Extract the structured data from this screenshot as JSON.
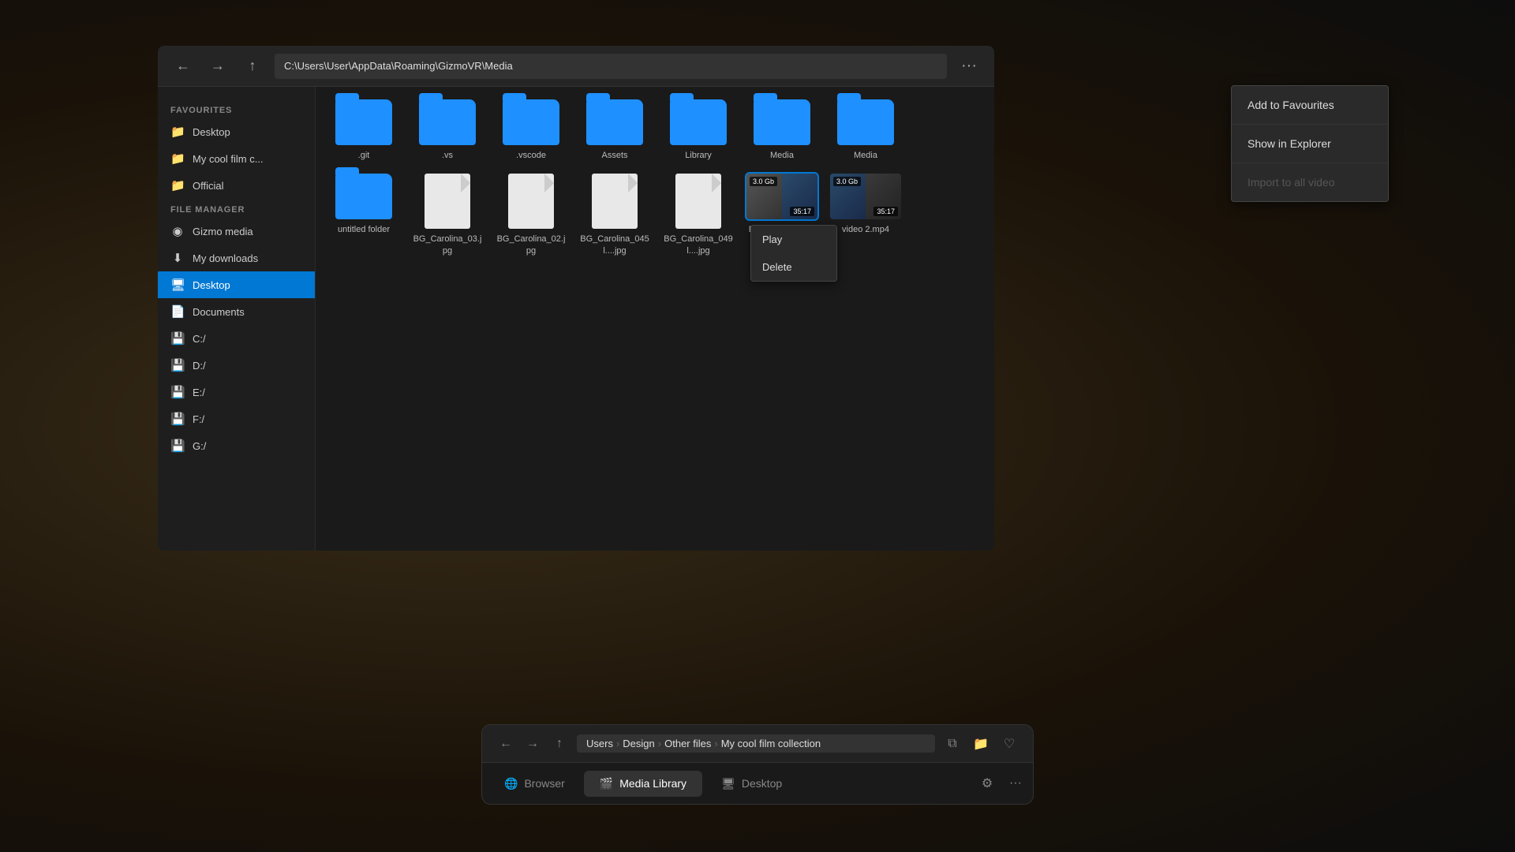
{
  "background": {
    "color": "#2a2010"
  },
  "window": {
    "titlebar": {
      "back_label": "←",
      "forward_label": "→",
      "up_label": "↑",
      "address": "C:\\Users\\User\\AppData\\Roaming\\GizmoVR\\Media",
      "more_label": "···"
    },
    "sidebar": {
      "favourites_label": "FAVOURITES",
      "favourite_items": [
        {
          "icon": "📁",
          "label": "Desktop"
        },
        {
          "icon": "📁",
          "label": "My cool film c..."
        },
        {
          "icon": "📁",
          "label": "Official"
        }
      ],
      "filemanager_label": "FILE MANAGER",
      "filemanager_items": [
        {
          "icon": "🎬",
          "label": "Gizmo media",
          "type": "media"
        },
        {
          "icon": "📥",
          "label": "My downloads",
          "type": "downloads"
        },
        {
          "icon": "🖥",
          "label": "Desktop",
          "type": "desktop",
          "active": true
        },
        {
          "icon": "📄",
          "label": "Documents",
          "type": "documents"
        },
        {
          "icon": "💾",
          "label": "C:/",
          "type": "drive"
        },
        {
          "icon": "💾",
          "label": "D:/",
          "type": "drive"
        },
        {
          "icon": "💾",
          "label": "E:/",
          "type": "drive"
        },
        {
          "icon": "💾",
          "label": "F:/",
          "type": "drive"
        },
        {
          "icon": "💾",
          "label": "G:/",
          "type": "drive"
        }
      ]
    },
    "file_grid": {
      "row1": [
        {
          "type": "folder",
          "name": ".git"
        },
        {
          "type": "folder",
          "name": ".vs"
        },
        {
          "type": "folder",
          "name": ".vscode"
        },
        {
          "type": "folder",
          "name": "Assets"
        },
        {
          "type": "folder",
          "name": "Library"
        },
        {
          "type": "folder",
          "name": "Media"
        },
        {
          "type": "folder",
          "name": "Media"
        }
      ],
      "row2": [
        {
          "type": "folder",
          "name": "untitled folder"
        },
        {
          "type": "doc",
          "name": "BG_Carolina_03.jpg"
        },
        {
          "type": "doc",
          "name": "BG_Carolina_02.jpg"
        },
        {
          "type": "doc",
          "name": "BG_Carolina_045 l....jpg"
        },
        {
          "type": "doc",
          "name": "BG_Carolina_049 l....jpg"
        },
        {
          "type": "video",
          "name": "BG_Carolina_4...",
          "size": "3.0 Gb",
          "duration": "35:17",
          "highlighted": true
        },
        {
          "type": "video2",
          "name": "video 2.mp4",
          "size": "3.0 Gb",
          "duration": "35:17"
        }
      ]
    },
    "video_context_menu": {
      "items": [
        {
          "label": "Play"
        },
        {
          "label": "Delete"
        }
      ]
    }
  },
  "dropdown_menu": {
    "items": [
      {
        "label": "Add to Favourites",
        "disabled": false
      },
      {
        "label": "Show in Explorer",
        "disabled": false
      },
      {
        "label": "Import to all video",
        "disabled": true
      }
    ]
  },
  "taskbar": {
    "breadcrumb": {
      "back": "←",
      "forward": "→",
      "up": "↑",
      "path": [
        {
          "label": "Users"
        },
        {
          "sep": "›"
        },
        {
          "label": "Design"
        },
        {
          "sep": "›"
        },
        {
          "label": "Other files"
        },
        {
          "sep": "›"
        },
        {
          "label": "My cool film collection"
        }
      ],
      "actions": [
        "⧉",
        "📁",
        "♡"
      ]
    },
    "tabs": [
      {
        "icon": "🌐",
        "label": "Browser",
        "active": false
      },
      {
        "icon": "🎬",
        "label": "Media Library",
        "active": true
      },
      {
        "icon": "🖥",
        "label": "Desktop",
        "active": false
      }
    ],
    "right_actions": [
      "⚙",
      "···"
    ]
  }
}
